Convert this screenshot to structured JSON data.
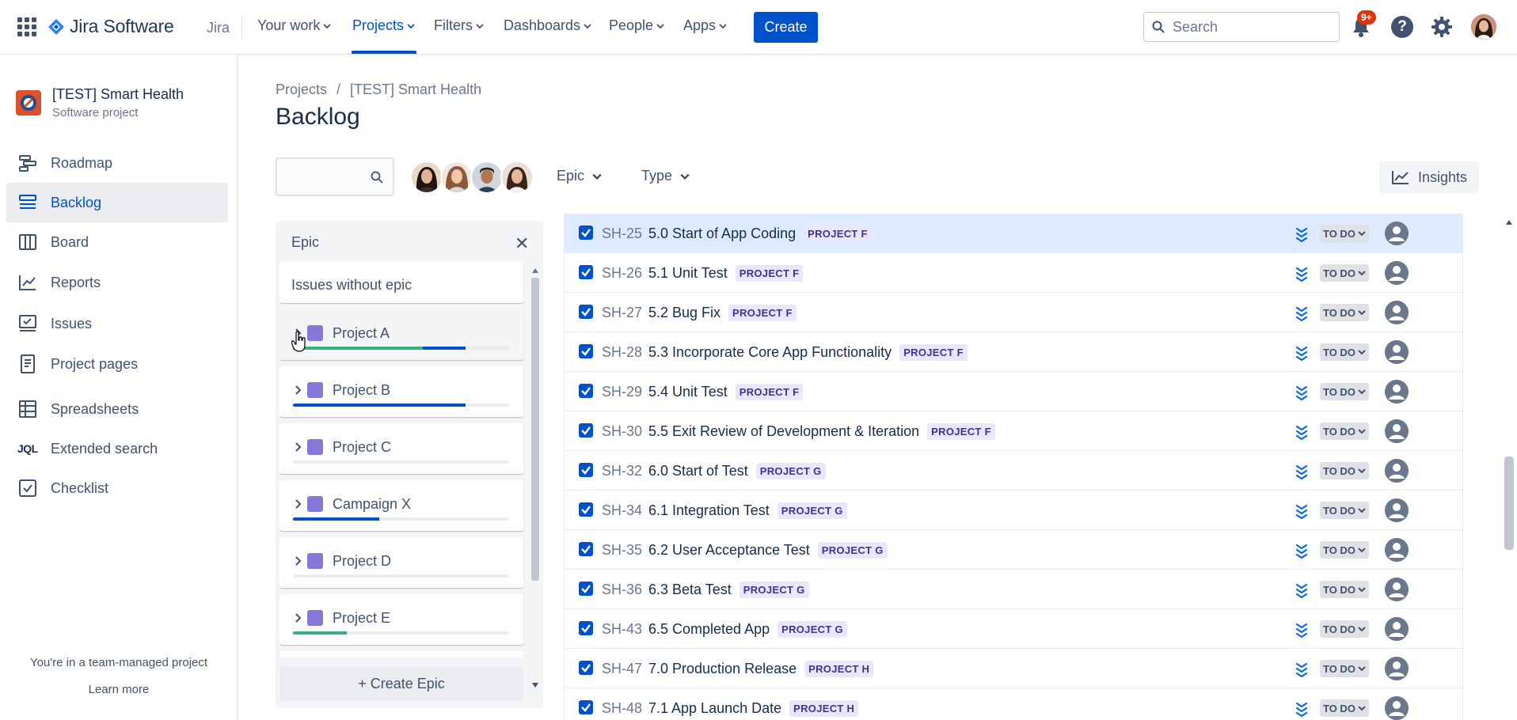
{
  "topnav": {
    "logo_text": "Jira Software",
    "product": "Jira",
    "items": [
      {
        "label": "Your work"
      },
      {
        "label": "Projects"
      },
      {
        "label": "Filters"
      },
      {
        "label": "Dashboards"
      },
      {
        "label": "People"
      },
      {
        "label": "Apps"
      }
    ],
    "create_label": "Create",
    "search_placeholder": "Search",
    "notifications_badge": "9+",
    "help_glyph": "?"
  },
  "sidebar": {
    "project_name": "[TEST] Smart Health",
    "project_type": "Software project",
    "items": [
      {
        "label": "Roadmap",
        "icon": "roadmap-icon"
      },
      {
        "label": "Backlog",
        "icon": "backlog-icon"
      },
      {
        "label": "Board",
        "icon": "board-icon"
      },
      {
        "label": "Reports",
        "icon": "reports-icon"
      },
      {
        "label": "Issues",
        "icon": "issues-icon"
      },
      {
        "label": "Project pages",
        "icon": "pages-icon"
      },
      {
        "label": "Spreadsheets",
        "icon": "spreadsheet-icon"
      },
      {
        "label": "Extended search",
        "icon": "jql-icon"
      },
      {
        "label": "Checklist",
        "icon": "checklist-icon"
      }
    ],
    "jql_glyph": "JQL",
    "team_note": "You're in a team-managed project",
    "learn_more": "Learn more"
  },
  "breadcrumb": {
    "root": "Projects",
    "separator": "/",
    "project": "[TEST] Smart Health"
  },
  "page_title": "Backlog",
  "filters": {
    "epic_label": "Epic",
    "type_label": "Type",
    "insights_label": "Insights"
  },
  "epic_panel": {
    "title": "Epic",
    "close_glyph": "✕",
    "no_epic_label": "Issues without epic",
    "epics": [
      {
        "name": "Project A",
        "done_pct": 0.6,
        "progress_pct": 0.8
      },
      {
        "name": "Project B",
        "done_pct": 0.0,
        "progress_pct": 0.8
      },
      {
        "name": "Project C",
        "done_pct": 0.0,
        "progress_pct": 0.0
      },
      {
        "name": "Campaign X",
        "done_pct": 0.0,
        "progress_pct": 0.4
      },
      {
        "name": "Project D",
        "done_pct": 0.0,
        "progress_pct": 0.0
      },
      {
        "name": "Project E",
        "done_pct": 0.25,
        "progress_pct": 0.0
      }
    ],
    "create_label": "+ Create Epic"
  },
  "issues": [
    {
      "key": "SH-25",
      "summary": "5.0 Start of App Coding",
      "epic": "PROJECT F",
      "status": "TO DO",
      "selected": true
    },
    {
      "key": "SH-26",
      "summary": "5.1 Unit Test",
      "epic": "PROJECT F",
      "status": "TO DO"
    },
    {
      "key": "SH-27",
      "summary": "5.2 Bug Fix",
      "epic": "PROJECT F",
      "status": "TO DO"
    },
    {
      "key": "SH-28",
      "summary": "5.3 Incorporate Core App Functionality",
      "epic": "PROJECT F",
      "status": "TO DO"
    },
    {
      "key": "SH-29",
      "summary": "5.4 Unit Test",
      "epic": "PROJECT F",
      "status": "TO DO"
    },
    {
      "key": "SH-30",
      "summary": "5.5 Exit Review of Development & Iteration",
      "epic": "PROJECT F",
      "status": "TO DO"
    },
    {
      "key": "SH-32",
      "summary": "6.0 Start of Test",
      "epic": "PROJECT G",
      "status": "TO DO"
    },
    {
      "key": "SH-34",
      "summary": "6.1 Integration Test",
      "epic": "PROJECT G",
      "status": "TO DO"
    },
    {
      "key": "SH-35",
      "summary": "6.2 User Acceptance Test",
      "epic": "PROJECT G",
      "status": "TO DO"
    },
    {
      "key": "SH-36",
      "summary": "6.3 Beta Test",
      "epic": "PROJECT G",
      "status": "TO DO"
    },
    {
      "key": "SH-43",
      "summary": "6.5 Completed App",
      "epic": "PROJECT G",
      "status": "TO DO"
    },
    {
      "key": "SH-47",
      "summary": "7.0 Production Release",
      "epic": "PROJECT H",
      "status": "TO DO"
    },
    {
      "key": "SH-48",
      "summary": "7.1 App Launch Date",
      "epic": "PROJECT H",
      "status": "TO DO"
    }
  ],
  "colors": {
    "brand": "#0052cc",
    "epic": "#8777d9",
    "lozenge_bg": "#eae6ff",
    "lozenge_text": "#403294",
    "done": "#36b37e"
  }
}
